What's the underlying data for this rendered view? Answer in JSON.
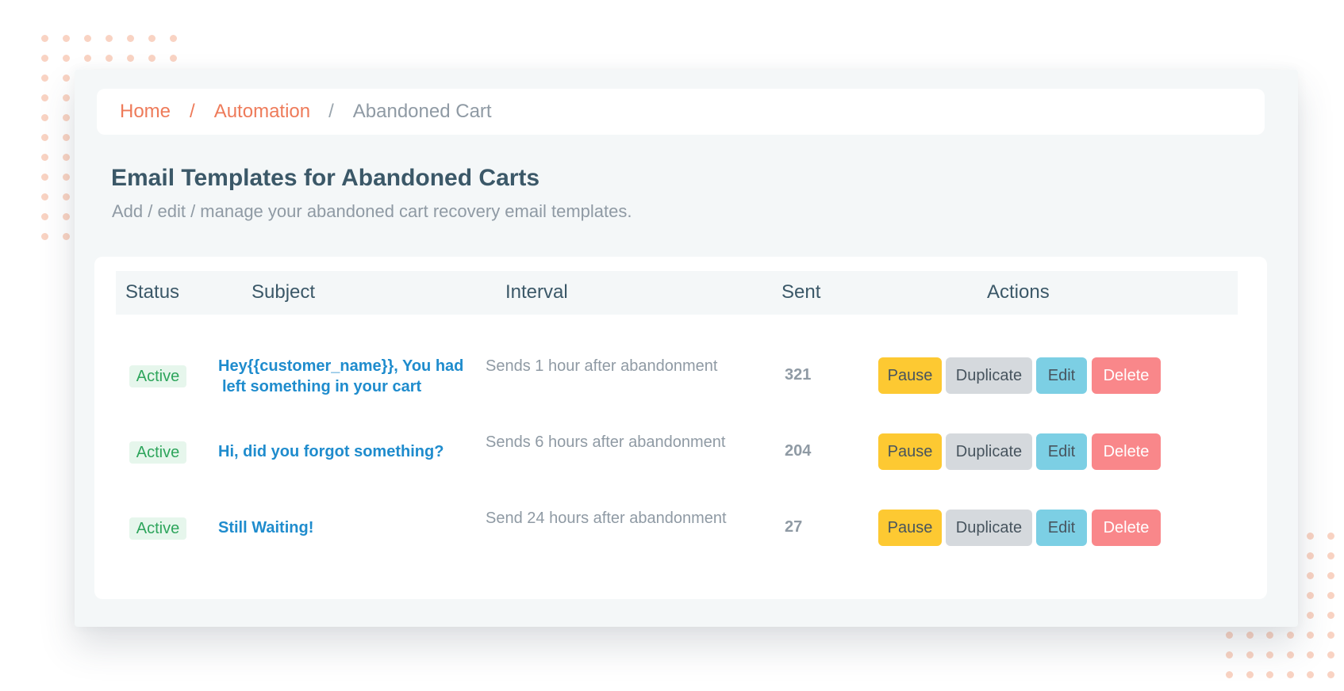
{
  "breadcrumb": {
    "home": "Home",
    "separator": "/",
    "automation": "Automation",
    "current": "Abandoned Cart"
  },
  "page": {
    "title": "Email Templates for Abandoned Carts",
    "subtitle": "Add / edit / manage your abandoned cart recovery email templates."
  },
  "table": {
    "headers": {
      "status": "Status",
      "subject": "Subject",
      "interval": "Interval",
      "sent": "Sent",
      "actions": "Actions"
    },
    "rows": [
      {
        "status": "Active",
        "subject_line1": "Hey{{customer_name}}, You had",
        "subject_line2": "left something in your cart",
        "interval": "Sends 1 hour after abandonment",
        "sent": "321"
      },
      {
        "status": "Active",
        "subject_line1": "Hi, did you forgot something?",
        "interval": "Sends 6 hours after abandonment",
        "sent": "204"
      },
      {
        "status": "Active",
        "subject_line1": "Still Waiting!",
        "interval": "Send 24 hours after abandonment",
        "sent": "27"
      }
    ],
    "actions": {
      "pause": "Pause",
      "duplicate": "Duplicate",
      "edit": "Edit",
      "delete": "Delete"
    }
  },
  "colors": {
    "accent": "#ee7b5a",
    "title": "#3b5868",
    "muted": "#8f9aa4",
    "subject_link": "#1f8ccd",
    "active_badge_bg": "#e6f6ec",
    "active_badge_text": "#2ea55c",
    "pause_button": "#fdc932",
    "duplicate_button": "#d5d9dd",
    "edit_button": "#7ccfe4",
    "delete_button": "#f9878a",
    "decorative_dots": "#f9d3c3"
  }
}
